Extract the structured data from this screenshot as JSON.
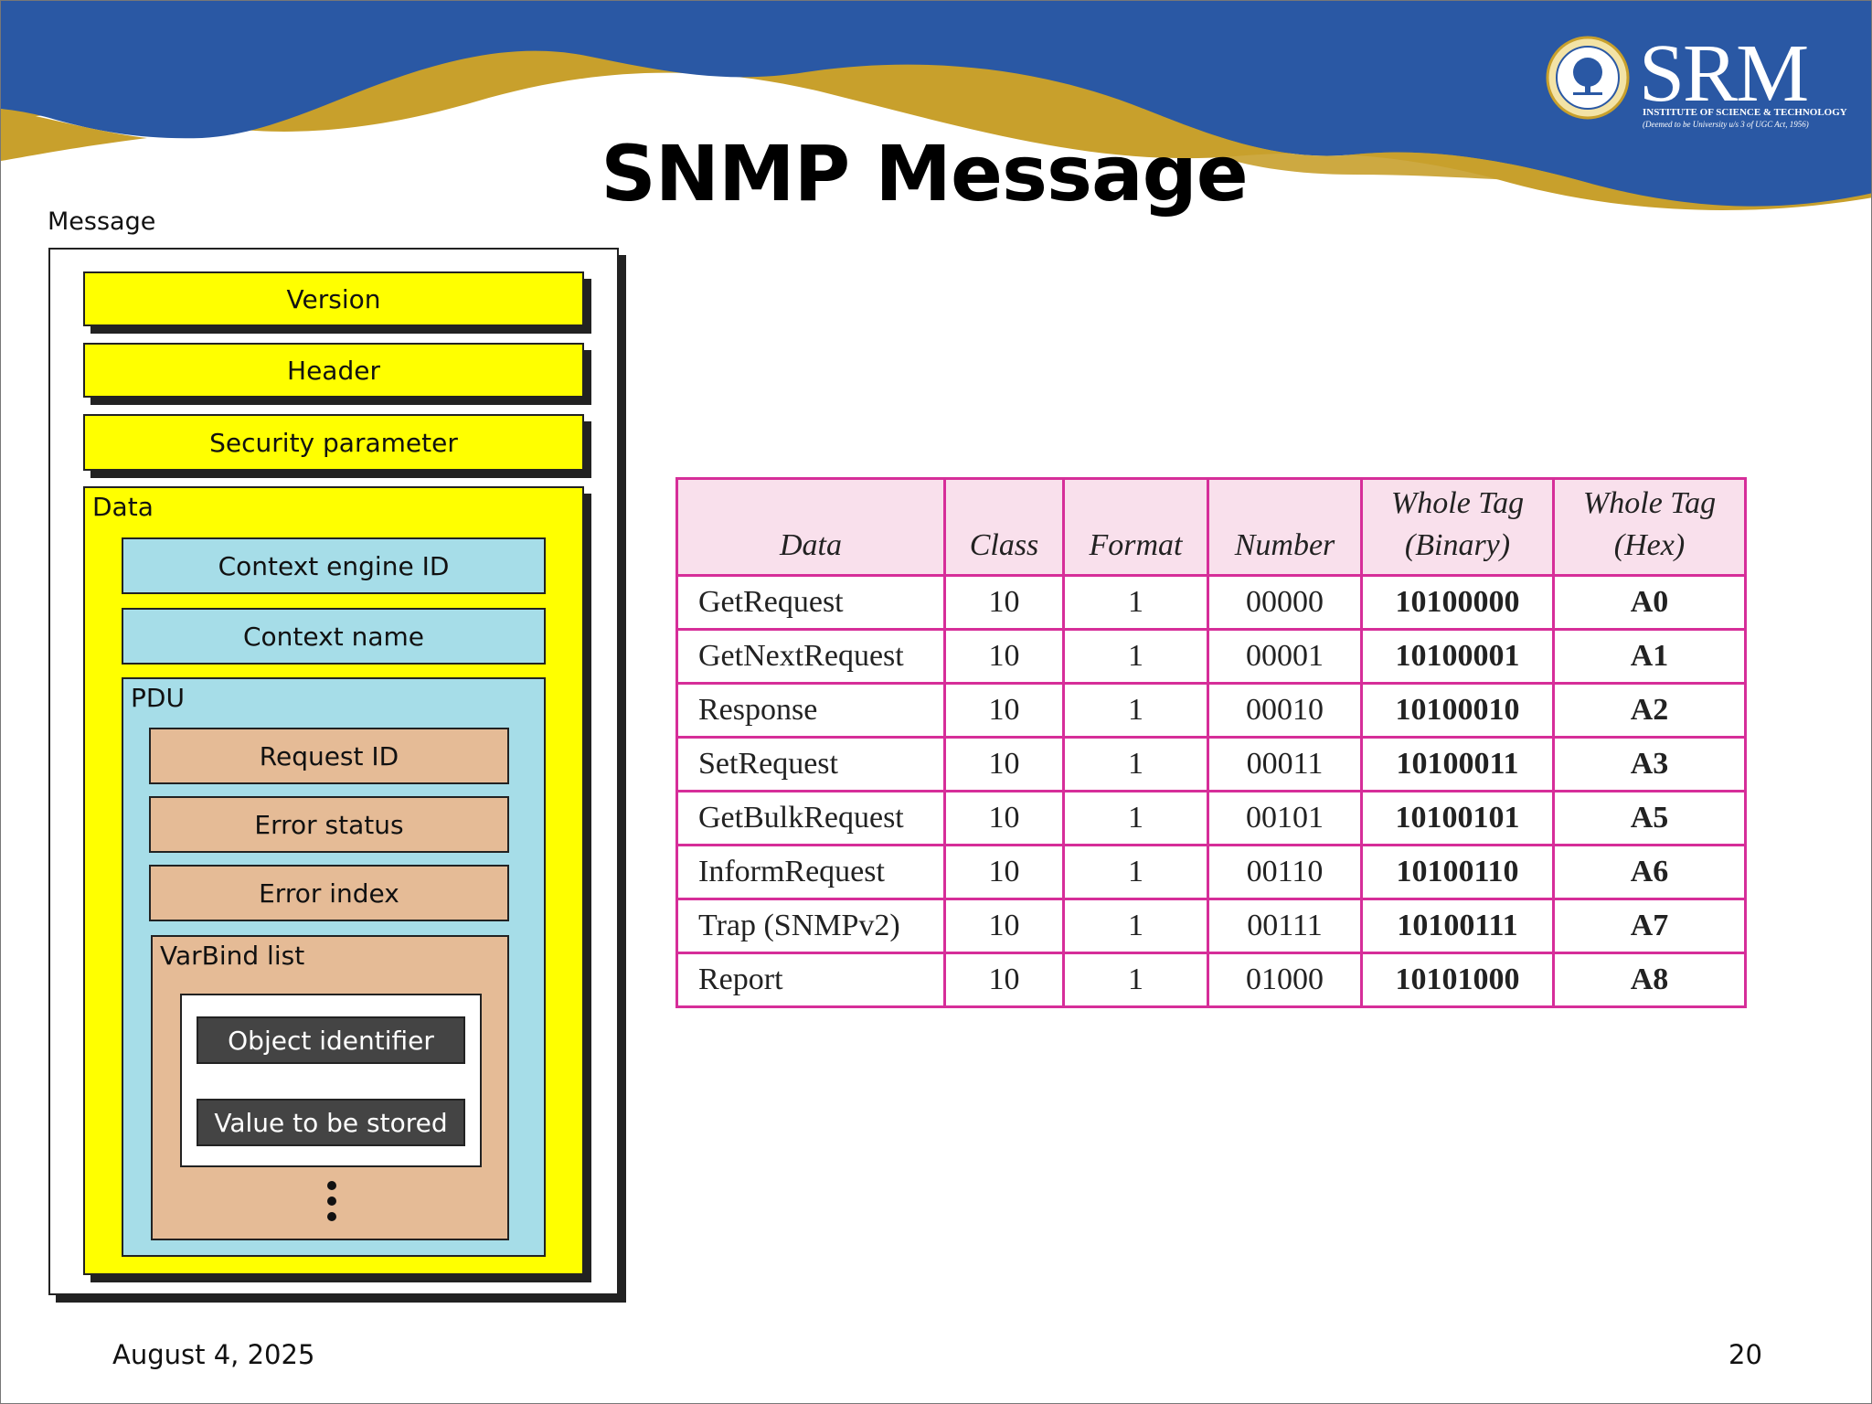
{
  "slide": {
    "title": "SNMP Message",
    "date": "August 4, 2025",
    "page_number": "20",
    "colors": {
      "banner_blue": "#2a58a4",
      "banner_gold": "#c8a02c",
      "table_border": "#d62e99",
      "table_header_bg": "#f9e0ec"
    }
  },
  "logo": {
    "name": "SRM",
    "subtitle": "INSTITUTE OF SCIENCE & TECHNOLOGY",
    "tagline": "(Deemed to be University u/s 3 of UGC Act, 1956)",
    "icon": "university-seal-icon"
  },
  "diagram": {
    "message_label": "Message",
    "version": "Version",
    "header": "Header",
    "security_parameter": "Security parameter",
    "data_label": "Data",
    "context_engine_id": "Context engine ID",
    "context_name": "Context name",
    "pdu_label": "PDU",
    "request_id": "Request ID",
    "error_status": "Error status",
    "error_index": "Error index",
    "varbind_label": "VarBind list",
    "object_identifier": "Object identifier",
    "value_to_be_stored": "Value to be stored",
    "ellipsis": "⋮"
  },
  "table": {
    "headers": [
      "Data",
      "Class",
      "Format",
      "Number",
      "Whole Tag (Binary)",
      "Whole Tag (Hex)"
    ],
    "header_lines": {
      "whole_tag_binary": [
        "Whole Tag",
        "(Binary)"
      ],
      "whole_tag_hex": [
        "Whole Tag",
        "(Hex)"
      ]
    },
    "rows": [
      [
        "GetRequest",
        "10",
        "1",
        "00000",
        "10100000",
        "A0"
      ],
      [
        "GetNextRequest",
        "10",
        "1",
        "00001",
        "10100001",
        "A1"
      ],
      [
        "Response",
        "10",
        "1",
        "00010",
        "10100010",
        "A2"
      ],
      [
        "SetRequest",
        "10",
        "1",
        "00011",
        "10100011",
        "A3"
      ],
      [
        "GetBulkRequest",
        "10",
        "1",
        "00101",
        "10100101",
        "A5"
      ],
      [
        "InformRequest",
        "10",
        "1",
        "00110",
        "10100110",
        "A6"
      ],
      [
        "Trap (SNMPv2)",
        "10",
        "1",
        "00111",
        "10100111",
        "A7"
      ],
      [
        "Report",
        "10",
        "1",
        "01000",
        "10101000",
        "A8"
      ]
    ]
  }
}
